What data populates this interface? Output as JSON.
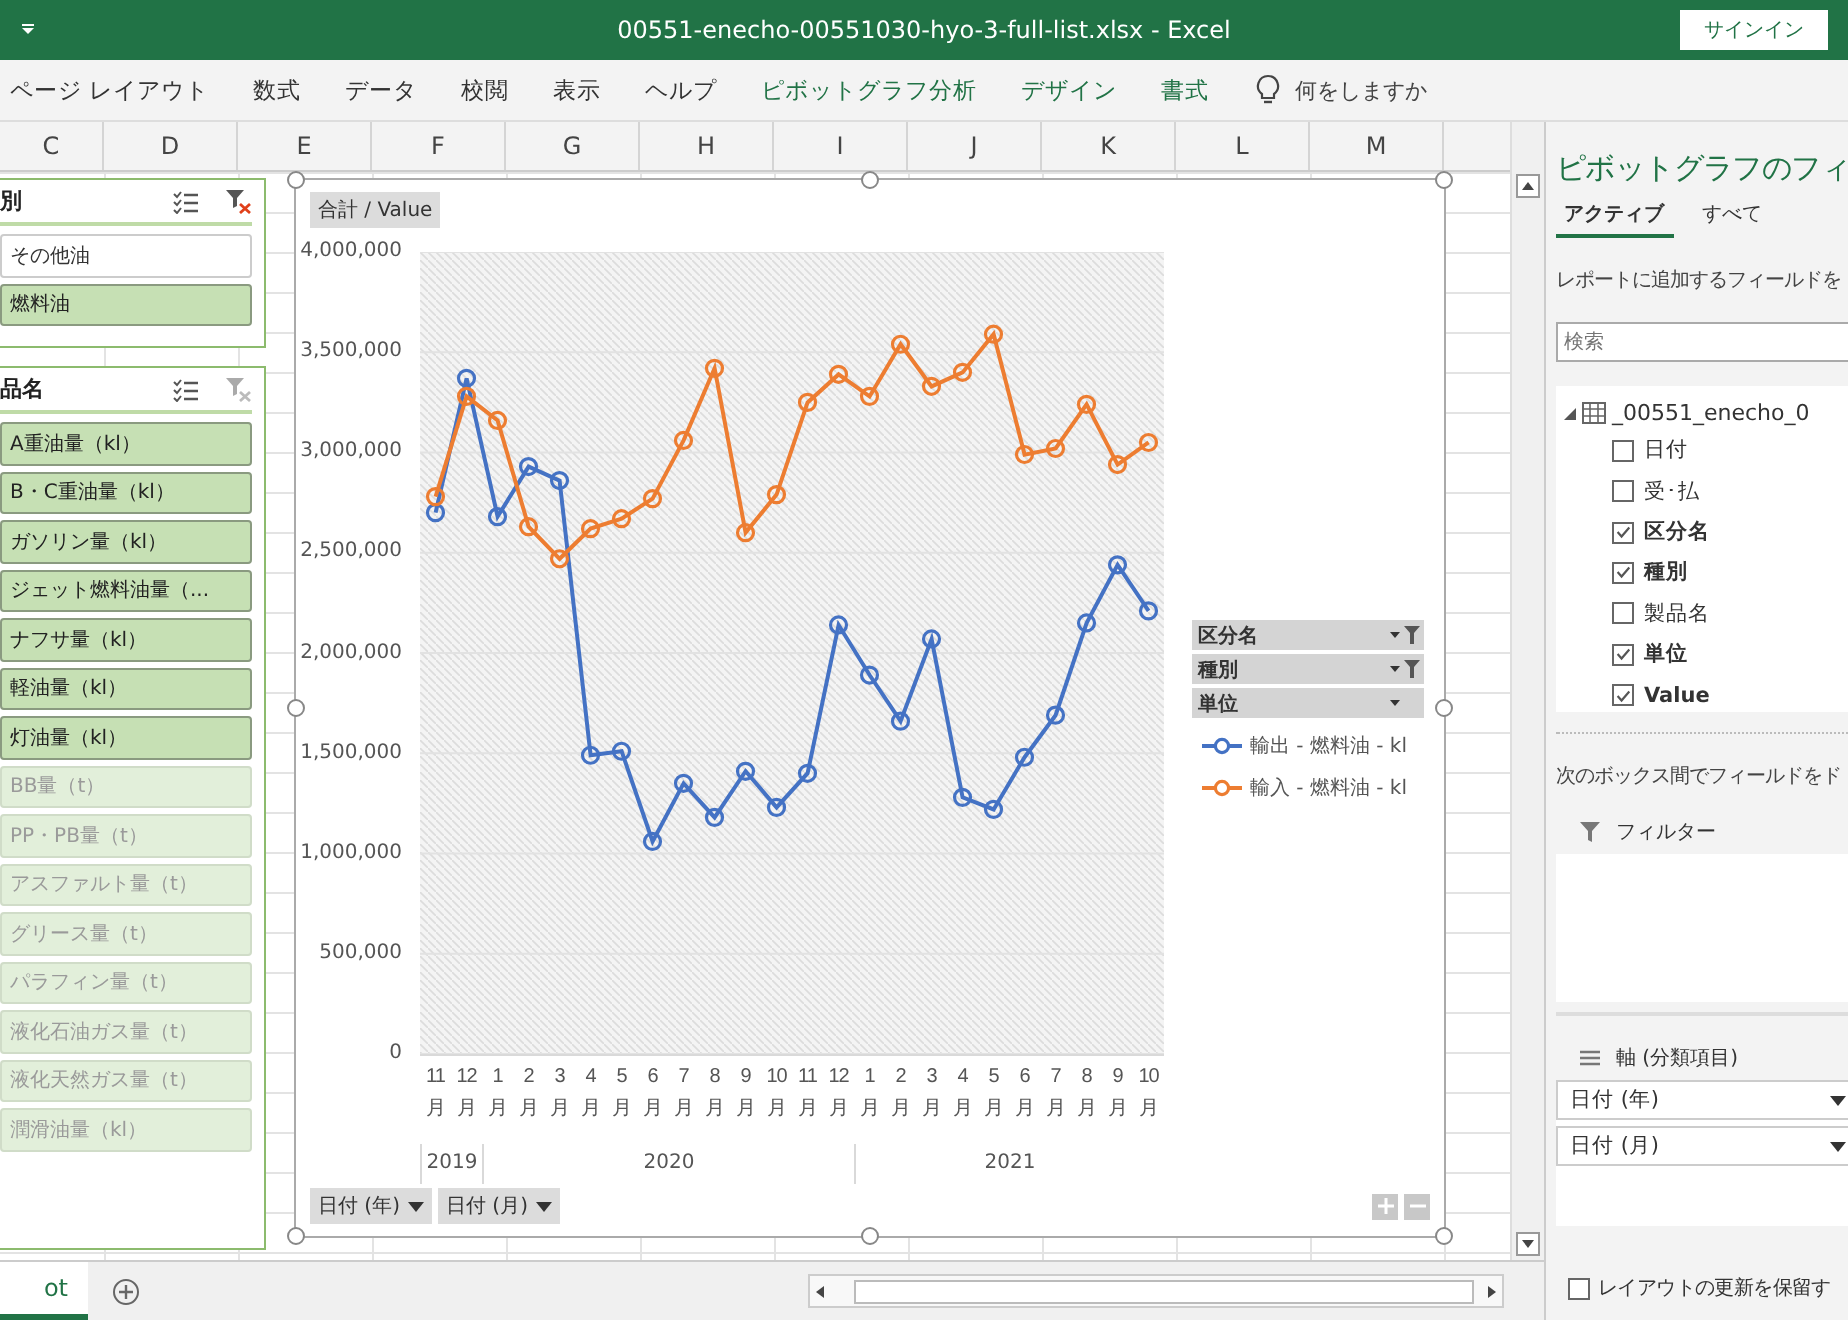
{
  "window": {
    "title": "00551-enecho-00551030-hyo-3-full-list.xlsx  -  Excel",
    "signin": "サインイン"
  },
  "ribbon_tabs": [
    {
      "label": "ページ レイアウト",
      "contextual": false
    },
    {
      "label": "数式",
      "contextual": false
    },
    {
      "label": "データ",
      "contextual": false
    },
    {
      "label": "校閲",
      "contextual": false
    },
    {
      "label": "表示",
      "contextual": false
    },
    {
      "label": "ヘルプ",
      "contextual": false
    },
    {
      "label": "ピボットグラフ分析",
      "contextual": true
    },
    {
      "label": "デザイン",
      "contextual": true
    },
    {
      "label": "書式",
      "contextual": true
    }
  ],
  "tell_me": {
    "placeholder": "何をしますか"
  },
  "columns": [
    "C",
    "D",
    "E",
    "F",
    "G",
    "H",
    "I",
    "J",
    "K",
    "L",
    "M"
  ],
  "slicers": [
    {
      "title": "別",
      "filter_cleared": false,
      "items": [
        {
          "label": "その他油",
          "selected": false
        },
        {
          "label": "燃料油",
          "selected": true
        }
      ]
    },
    {
      "title": "品名",
      "filter_cleared": true,
      "items": [
        {
          "label": "A重油量（kl）",
          "selected": true
        },
        {
          "label": "B・C重油量（kl）",
          "selected": true
        },
        {
          "label": "ガソリン量（kl）",
          "selected": true
        },
        {
          "label": "ジェット燃料油量（...",
          "selected": true
        },
        {
          "label": "ナフサ量（kl）",
          "selected": true
        },
        {
          "label": "軽油量（kl）",
          "selected": true
        },
        {
          "label": "灯油量（kl）",
          "selected": true
        },
        {
          "label": "BB量（t）",
          "selected": false
        },
        {
          "label": "PP・PB量（t）",
          "selected": false
        },
        {
          "label": "アスファルト量（t）",
          "selected": false
        },
        {
          "label": "グリース量（t）",
          "selected": false
        },
        {
          "label": "パラフィン量（t）",
          "selected": false
        },
        {
          "label": "液化石油ガス量（t）",
          "selected": false
        },
        {
          "label": "液化天然ガス量（t）",
          "selected": false
        },
        {
          "label": "潤滑油量（kl）",
          "selected": false
        }
      ]
    }
  ],
  "chart": {
    "value_field": "合計 / Value",
    "legend_fields": [
      {
        "label": "区分名",
        "filtered": true
      },
      {
        "label": "種別",
        "filtered": true
      },
      {
        "label": "単位",
        "filtered": false
      }
    ],
    "axis_fields": [
      "日付 (年)",
      "日付 (月)"
    ],
    "chart_data": {
      "type": "line",
      "categories": [
        "11月",
        "12月",
        "1月",
        "2月",
        "3月",
        "4月",
        "5月",
        "6月",
        "7月",
        "8月",
        "9月",
        "10月",
        "11月",
        "12月",
        "1月",
        "2月",
        "3月",
        "4月",
        "5月",
        "6月",
        "7月",
        "8月",
        "9月",
        "10月"
      ],
      "annotations": [
        "2019",
        "2020",
        "2021"
      ],
      "grid": true,
      "ylim": [
        0,
        4000000
      ],
      "yticks": [
        {
          "value": 0,
          "label": "0"
        },
        {
          "value": 500000,
          "label": "500,000"
        },
        {
          "value": 1000000,
          "label": "1,000,000"
        },
        {
          "value": 1500000,
          "label": "1,500,000"
        },
        {
          "value": 2000000,
          "label": "2,000,000"
        },
        {
          "value": 2500000,
          "label": "2,500,000"
        },
        {
          "value": 3000000,
          "label": "3,000,000"
        },
        {
          "value": 3500000,
          "label": "3,500,000"
        },
        {
          "value": 4000000,
          "label": "4,000,000"
        }
      ],
      "series": [
        {
          "name": "輸出 - 燃料油 - kl",
          "color": "#4472c4",
          "marker": "circle",
          "values": [
            2700000,
            3370000,
            2680000,
            2930000,
            2860000,
            1490000,
            1510000,
            1060000,
            1350000,
            1180000,
            1410000,
            1230000,
            1400000,
            2140000,
            1890000,
            1660000,
            2070000,
            1280000,
            1220000,
            1480000,
            1690000,
            2150000,
            2440000,
            2210000
          ]
        },
        {
          "name": "輸入 - 燃料油 - kl",
          "color": "#ed7d31",
          "marker": "circle",
          "values": [
            2780000,
            3280000,
            3160000,
            2630000,
            2470000,
            2620000,
            2670000,
            2770000,
            3060000,
            3420000,
            2600000,
            2790000,
            3250000,
            3390000,
            3280000,
            3540000,
            3330000,
            3400000,
            3590000,
            2990000,
            3020000,
            3240000,
            2940000,
            3050000
          ]
        }
      ]
    }
  },
  "sheet_tab": "ot",
  "pane": {
    "title": "ピボットグラフのフィ",
    "tabs": [
      {
        "label": "アクティブ",
        "selected": true
      },
      {
        "label": "すべて",
        "selected": false
      }
    ],
    "instruction": "レポートに追加するフィールドを",
    "search": {
      "placeholder": "検索"
    },
    "table_name": "_00551_enecho_0",
    "fields": [
      {
        "label": "日付",
        "checked": false
      },
      {
        "label": "受･払",
        "checked": false
      },
      {
        "label": "区分名",
        "checked": true
      },
      {
        "label": "種別",
        "checked": true
      },
      {
        "label": "製品名",
        "checked": false
      },
      {
        "label": "単位",
        "checked": true
      },
      {
        "label": "Value",
        "checked": true
      }
    ],
    "drag_hint": "次のボックス間でフィールドをド",
    "filter_area": {
      "label": "フィルター"
    },
    "axis_area": {
      "label": "軸 (分類項目)",
      "items": [
        "日付 (年)",
        "日付 (月)"
      ]
    },
    "defer_update": {
      "label": "レイアウトの更新を保留す",
      "checked": false
    }
  }
}
